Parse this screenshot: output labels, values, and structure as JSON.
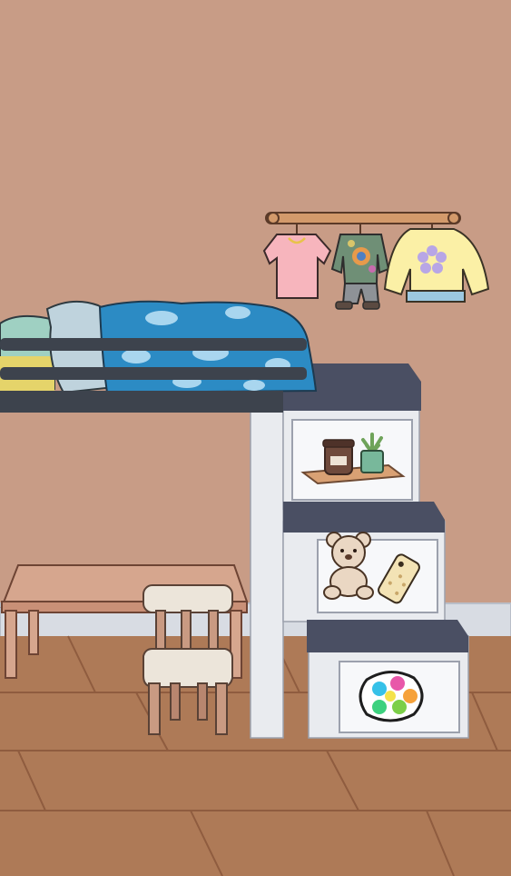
{
  "scene": {
    "colors": {
      "wall": "#C89C86",
      "floor": "#AE7A57",
      "floor_line": "#8F5C3F",
      "baseboard": "#D8DCE3",
      "stairs_body": "#E9EBEF",
      "stairs_top": "#4A4F63",
      "bed_frame": "#3D434D",
      "blanket": "#2C8BC4",
      "desk": "#D6A68E",
      "chair_seat": "#ECE5DA",
      "chair_legs": "#C99A82"
    },
    "objects": [
      {
        "id": "clothes-rack",
        "icon": "clothes-rack-icon"
      },
      {
        "id": "pink-tshirt",
        "icon": "tshirt-icon"
      },
      {
        "id": "tie-dye-outfit",
        "icon": "outfit-icon"
      },
      {
        "id": "yellow-flower-sweater",
        "icon": "sweater-icon"
      },
      {
        "id": "loft-bed",
        "icon": "bed-icon"
      },
      {
        "id": "candle-tray",
        "icon": "candle-icon"
      },
      {
        "id": "succulent",
        "icon": "plant-icon"
      },
      {
        "id": "teddy-bear",
        "icon": "teddy-bear-icon"
      },
      {
        "id": "phone",
        "icon": "phone-icon"
      },
      {
        "id": "pop-it-toy",
        "icon": "pop-it-icon"
      },
      {
        "id": "desk",
        "icon": "table-icon"
      },
      {
        "id": "chair",
        "icon": "chair-icon"
      }
    ]
  }
}
